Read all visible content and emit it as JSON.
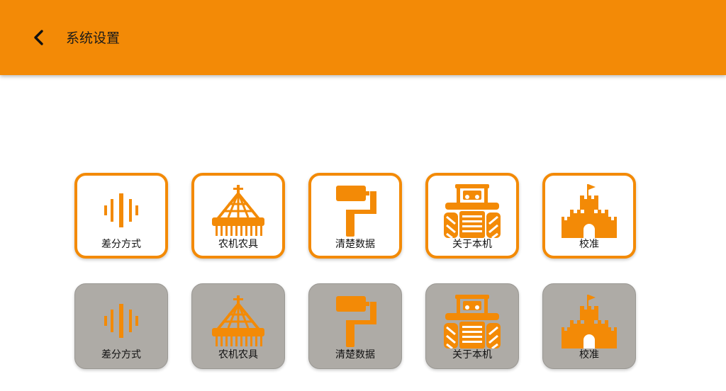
{
  "header": {
    "title": "系统设置",
    "back_icon": "chevron-left-icon"
  },
  "colors": {
    "accent": "#f38a06",
    "inactive_tile": "#aeaba6",
    "background": "#ffffff"
  },
  "grid": {
    "active_row": [
      {
        "label": "差分方式",
        "icon": "soundwave-icon"
      },
      {
        "label": "农机农具",
        "icon": "farm-implement-icon"
      },
      {
        "label": "清楚数据",
        "icon": "paint-roller-icon"
      },
      {
        "label": "关于本机",
        "icon": "tractor-icon"
      },
      {
        "label": "校准",
        "icon": "castle-icon"
      }
    ],
    "inactive_row": [
      {
        "label": "差分方式",
        "icon": "soundwave-icon"
      },
      {
        "label": "农机农具",
        "icon": "farm-implement-icon"
      },
      {
        "label": "清楚数据",
        "icon": "paint-roller-icon"
      },
      {
        "label": "关于本机",
        "icon": "tractor-icon"
      },
      {
        "label": "校准",
        "icon": "castle-icon"
      }
    ]
  }
}
